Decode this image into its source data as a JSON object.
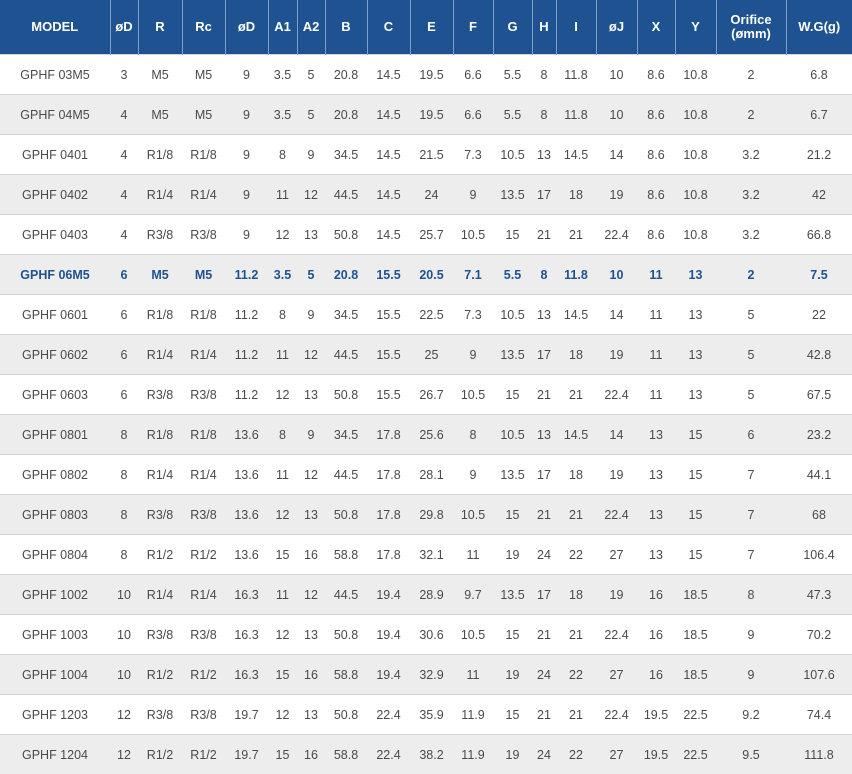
{
  "columns": [
    "MODEL",
    "øD",
    "R",
    "Rc",
    "øD",
    "A1",
    "A2",
    "B",
    "C",
    "E",
    "F",
    "G",
    "H",
    "I",
    "øJ",
    "X",
    "Y",
    "Orifice\n(ømm)",
    "W.G(g)"
  ],
  "highlight_row": 5,
  "rows": [
    [
      "GPHF 03M5",
      "3",
      "M5",
      "M5",
      "9",
      "3.5",
      "5",
      "20.8",
      "14.5",
      "19.5",
      "6.6",
      "5.5",
      "8",
      "11.8",
      "10",
      "8.6",
      "10.8",
      "2",
      "6.8"
    ],
    [
      "GPHF 04M5",
      "4",
      "M5",
      "M5",
      "9",
      "3.5",
      "5",
      "20.8",
      "14.5",
      "19.5",
      "6.6",
      "5.5",
      "8",
      "11.8",
      "10",
      "8.6",
      "10.8",
      "2",
      "6.7"
    ],
    [
      "GPHF 0401",
      "4",
      "R1/8",
      "R1/8",
      "9",
      "8",
      "9",
      "34.5",
      "14.5",
      "21.5",
      "7.3",
      "10.5",
      "13",
      "14.5",
      "14",
      "8.6",
      "10.8",
      "3.2",
      "21.2"
    ],
    [
      "GPHF 0402",
      "4",
      "R1/4",
      "R1/4",
      "9",
      "11",
      "12",
      "44.5",
      "14.5",
      "24",
      "9",
      "13.5",
      "17",
      "18",
      "19",
      "8.6",
      "10.8",
      "3.2",
      "42"
    ],
    [
      "GPHF 0403",
      "4",
      "R3/8",
      "R3/8",
      "9",
      "12",
      "13",
      "50.8",
      "14.5",
      "25.7",
      "10.5",
      "15",
      "21",
      "21",
      "22.4",
      "8.6",
      "10.8",
      "3.2",
      "66.8"
    ],
    [
      "GPHF 06M5",
      "6",
      "M5",
      "M5",
      "11.2",
      "3.5",
      "5",
      "20.8",
      "15.5",
      "20.5",
      "7.1",
      "5.5",
      "8",
      "11.8",
      "10",
      "11",
      "13",
      "2",
      "7.5"
    ],
    [
      "GPHF 0601",
      "6",
      "R1/8",
      "R1/8",
      "11.2",
      "8",
      "9",
      "34.5",
      "15.5",
      "22.5",
      "7.3",
      "10.5",
      "13",
      "14.5",
      "14",
      "11",
      "13",
      "5",
      "22"
    ],
    [
      "GPHF 0602",
      "6",
      "R1/4",
      "R1/4",
      "11.2",
      "11",
      "12",
      "44.5",
      "15.5",
      "25",
      "9",
      "13.5",
      "17",
      "18",
      "19",
      "11",
      "13",
      "5",
      "42.8"
    ],
    [
      "GPHF 0603",
      "6",
      "R3/8",
      "R3/8",
      "11.2",
      "12",
      "13",
      "50.8",
      "15.5",
      "26.7",
      "10.5",
      "15",
      "21",
      "21",
      "22.4",
      "11",
      "13",
      "5",
      "67.5"
    ],
    [
      "GPHF 0801",
      "8",
      "R1/8",
      "R1/8",
      "13.6",
      "8",
      "9",
      "34.5",
      "17.8",
      "25.6",
      "8",
      "10.5",
      "13",
      "14.5",
      "14",
      "13",
      "15",
      "6",
      "23.2"
    ],
    [
      "GPHF 0802",
      "8",
      "R1/4",
      "R1/4",
      "13.6",
      "11",
      "12",
      "44.5",
      "17.8",
      "28.1",
      "9",
      "13.5",
      "17",
      "18",
      "19",
      "13",
      "15",
      "7",
      "44.1"
    ],
    [
      "GPHF 0803",
      "8",
      "R3/8",
      "R3/8",
      "13.6",
      "12",
      "13",
      "50.8",
      "17.8",
      "29.8",
      "10.5",
      "15",
      "21",
      "21",
      "22.4",
      "13",
      "15",
      "7",
      "68"
    ],
    [
      "GPHF 0804",
      "8",
      "R1/2",
      "R1/2",
      "13.6",
      "15",
      "16",
      "58.8",
      "17.8",
      "32.1",
      "11",
      "19",
      "24",
      "22",
      "27",
      "13",
      "15",
      "7",
      "106.4"
    ],
    [
      "GPHF 1002",
      "10",
      "R1/4",
      "R1/4",
      "16.3",
      "11",
      "12",
      "44.5",
      "19.4",
      "28.9",
      "9.7",
      "13.5",
      "17",
      "18",
      "19",
      "16",
      "18.5",
      "8",
      "47.3"
    ],
    [
      "GPHF 1003",
      "10",
      "R3/8",
      "R3/8",
      "16.3",
      "12",
      "13",
      "50.8",
      "19.4",
      "30.6",
      "10.5",
      "15",
      "21",
      "21",
      "22.4",
      "16",
      "18.5",
      "9",
      "70.2"
    ],
    [
      "GPHF 1004",
      "10",
      "R1/2",
      "R1/2",
      "16.3",
      "15",
      "16",
      "58.8",
      "19.4",
      "32.9",
      "11",
      "19",
      "24",
      "22",
      "27",
      "16",
      "18.5",
      "9",
      "107.6"
    ],
    [
      "GPHF 1203",
      "12",
      "R3/8",
      "R3/8",
      "19.7",
      "12",
      "13",
      "50.8",
      "22.4",
      "35.9",
      "11.9",
      "15",
      "21",
      "21",
      "22.4",
      "19.5",
      "22.5",
      "9.2",
      "74.4"
    ],
    [
      "GPHF 1204",
      "12",
      "R1/2",
      "R1/2",
      "19.7",
      "15",
      "16",
      "58.8",
      "22.4",
      "38.2",
      "11.9",
      "19",
      "24",
      "22",
      "27",
      "19.5",
      "22.5",
      "9.5",
      "111.8"
    ]
  ]
}
